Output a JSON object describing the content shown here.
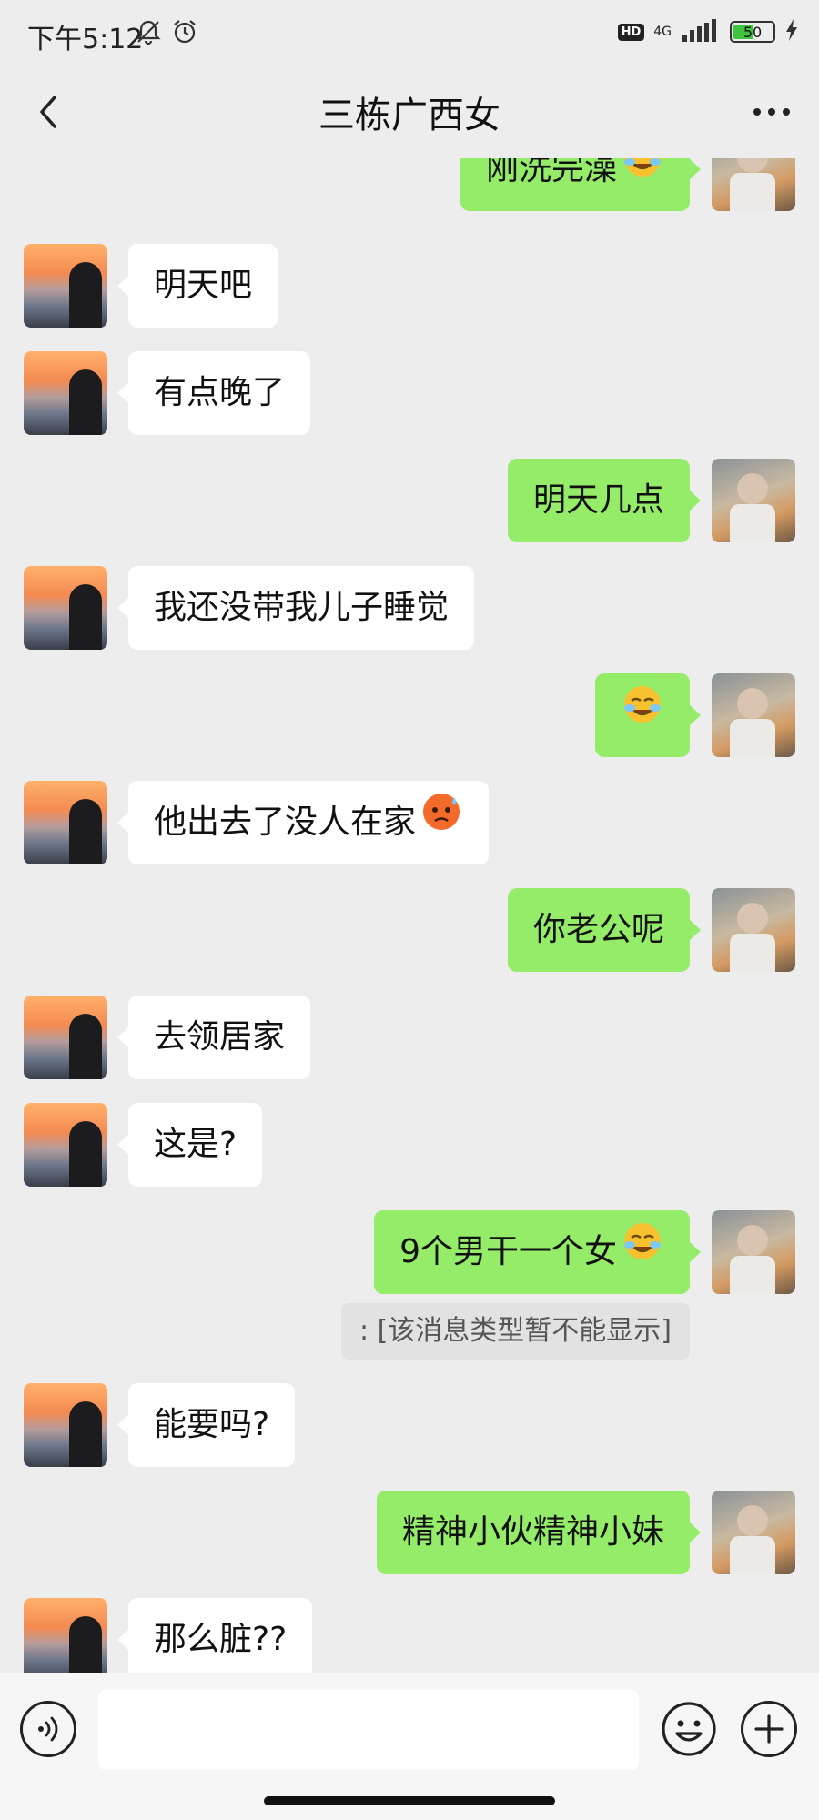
{
  "status_bar": {
    "time": "下午5:12",
    "hd": "HD",
    "network": "4G",
    "battery_level": "50",
    "icons": [
      "mute-bell-icon",
      "alarm-icon",
      "signal-icon",
      "battery-icon",
      "charging-icon"
    ]
  },
  "nav": {
    "title": "三栋广西女",
    "back_icon": "chevron-left-icon",
    "more_icon": "more-dots-icon"
  },
  "messages": [
    {
      "side": "right",
      "text": "刚洗完澡",
      "emoji": "face-palm-emoji"
    },
    {
      "side": "left",
      "text": "明天吧"
    },
    {
      "side": "left",
      "text": "有点晚了"
    },
    {
      "side": "right",
      "text": "明天几点"
    },
    {
      "side": "left",
      "text": "我还没带我儿子睡觉"
    },
    {
      "side": "right",
      "text": "",
      "emoji": "face-palm-emoji"
    },
    {
      "side": "left",
      "text": "他出去了没人在家",
      "emoji": "sweat-face-emoji"
    },
    {
      "side": "right",
      "text": "你老公呢"
    },
    {
      "side": "left",
      "text": "去领居家"
    },
    {
      "side": "left",
      "text": "这是?"
    },
    {
      "side": "right",
      "text": "9个男干一个女",
      "emoji": "face-palm-emoji"
    },
    {
      "side": "left",
      "text": "能要吗?"
    },
    {
      "side": "right",
      "text": "精神小伙精神小妹"
    },
    {
      "side": "left",
      "text": "那么脏??"
    }
  ],
  "system_note": ": [该消息类型暂不能显示]",
  "input_bar": {
    "voice_icon": "voice-icon",
    "input_value": "",
    "emoji_icon": "emoji-smile-icon",
    "plus_icon": "plus-icon"
  },
  "colors": {
    "background": "#ededed",
    "own_bubble": "#95ec69",
    "other_bubble": "#ffffff",
    "input_bar": "#f6f6f6"
  }
}
